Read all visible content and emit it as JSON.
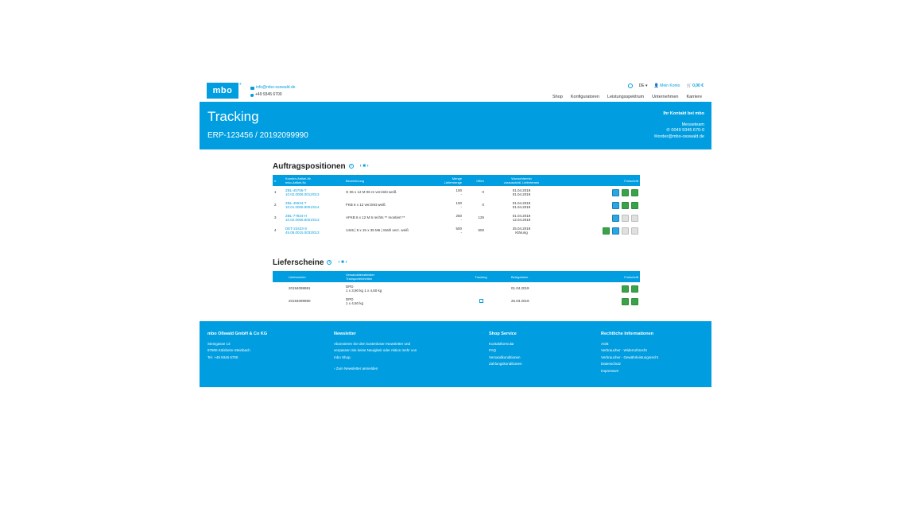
{
  "header": {
    "logo": "mbo",
    "logo_mark": "®",
    "email": "info@mbo-osswald.de",
    "phone": "+49 9345 6700",
    "lang": "DE ▾",
    "account": "Mein Konto",
    "cart": "0,00 €",
    "nav": [
      "Shop",
      "Konfiguratoren",
      "Leistungsspektrum",
      "Unternehmen",
      "Karriere"
    ]
  },
  "hero": {
    "title": "Tracking",
    "subtitle": "ERP-123456 / 20192099990",
    "contact_head": "Ihr Kontakt bei mbo",
    "contact_team": "Messeteam",
    "contact_phone": "0049 9345 670-0",
    "contact_email": "order@mbo-osswald.de"
  },
  "positions": {
    "title": "Auftragspositionen",
    "pager": "‹ ■ ›",
    "columns": [
      "#",
      "Kunden-Artikel-Nr.\nmbo-Artikel-Nr.",
      "Bezeichnung",
      "Menge\nLiefermenge",
      "Offen",
      "Wunschtermin\nvoraussichtl. Liefertermin",
      "Fortschritt"
    ],
    "rows": [
      {
        "n": "1",
        "a1": "ZBL-45756-T",
        "a2": "10.02.0006.0012/013",
        "desc": "G 06 x 12 M 06 re verzinkt weiß",
        "q1": "100",
        "q2": "-",
        "open": "0",
        "d1": "01.04.2019",
        "d2": "01.04.2019",
        "prog": [
          "blue",
          "green",
          "green"
        ]
      },
      {
        "n": "2",
        "a1": "ZBL-45534-T",
        "a2": "10.01.0006.8001/014",
        "desc": "FKB 6 x 12 verzinkt weiß",
        "q1": "100",
        "q2": "-",
        "open": "0",
        "d1": "01.04.2019",
        "d2": "01.04.2019",
        "prog": [
          "blue",
          "green",
          "green"
        ]
      },
      {
        "n": "3",
        "a1": "ZBL-77834-H",
        "a2": "10.02.0006.8001/013",
        "desc": "AFKB 6 x 12 M 6 rechts ** montiert **",
        "q1": "250",
        "q2": "-",
        "open": "125",
        "d1": "01.04.2019",
        "d2": "12.04.2019",
        "prog": [
          "blue",
          "grey",
          "grey"
        ]
      },
      {
        "n": "4",
        "a1": "DET-23423-S",
        "a2": "45.08.0015.0033/013",
        "desc": "1445 | 8 x 15 x 35 M6 | Stahl verz. weiß",
        "q1": "500",
        "q2": "-",
        "open": "500",
        "d1": "25.04.2019",
        "d2": "Klärung",
        "prog": [
          "green",
          "blue",
          "grey",
          "grey"
        ]
      }
    ]
  },
  "delivery": {
    "title": "Lieferscheine",
    "pager": "‹ ■ ›",
    "columns": [
      "Lieferschein",
      "Versanddienstleister\nTransporteinheiten",
      "Tracking",
      "Belegdatum",
      "Fortschritt"
    ],
    "rows": [
      {
        "id": "20194099991",
        "c1": "DPD",
        "c2": "1 x 3,90 kg 1 x 4,60 kg",
        "date": "01.04.2019",
        "track": false
      },
      {
        "id": "20194099990",
        "c1": "DPD",
        "c2": "1 x 4,50 kg",
        "date": "25.03.2019",
        "track": true
      }
    ]
  },
  "footer": {
    "company": "mbo Oßwald GmbH & Co KG",
    "address": [
      "Steingasse 13",
      "97900 Külsheim-Steinbach",
      "Tel. +49 9345 6700"
    ],
    "newsletter_head": "Newsletter",
    "newsletter_text": [
      "Abonnieren Sie den kostenlosen Newsletter und",
      "verpassen Sie keine Neuigkeit oder Aktion mehr von",
      "mbo Shop."
    ],
    "newsletter_link": "Zum Newsletter anmelden",
    "service_head": "Shop Service",
    "service": [
      "Kontaktformular",
      "FAQ",
      "Versandkonditionen",
      "Zahlungskonditionen"
    ],
    "legal_head": "Rechtliche Informationen",
    "legal": [
      "AGB",
      "Verbraucher - Widerrufsrecht",
      "Verbraucher - Gewährleistungsrecht",
      "Datenschutz",
      "Impressum"
    ]
  },
  "colors": {
    "brand": "#009ee0",
    "progress_green": "#3aa34a"
  }
}
